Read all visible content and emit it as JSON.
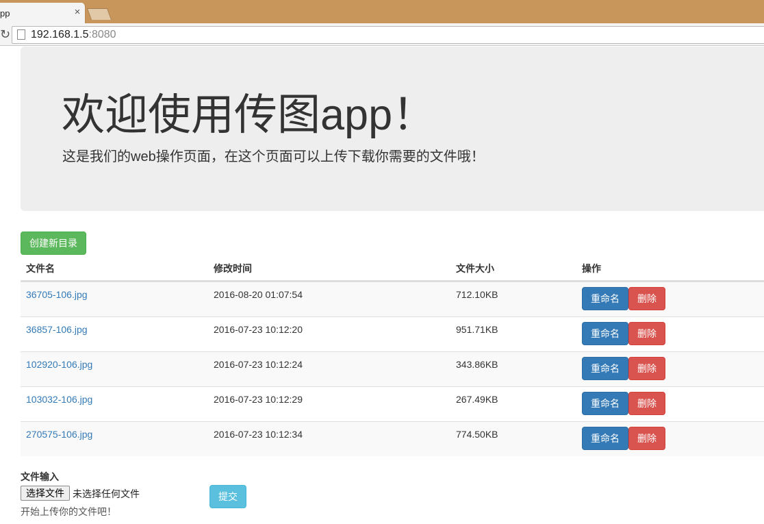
{
  "browser": {
    "tab_title": "pp",
    "close_glyph": "×",
    "url_host": "192.168.1.5",
    "url_port": ":8080"
  },
  "jumbotron": {
    "title": "欢迎使用传图app！",
    "subtitle": "这是我们的web操作页面，在这个页面可以上传下载你需要的文件哦！"
  },
  "actions": {
    "create_dir_label": "创建新目录"
  },
  "table": {
    "headers": [
      "文件名",
      "修改时间",
      "文件大小",
      "操作"
    ],
    "rename_label": "重命名",
    "delete_label": "删除",
    "rows": [
      {
        "name": "36705-106.jpg",
        "modified": "2016-08-20 01:07:54",
        "size": "712.10KB"
      },
      {
        "name": "36857-106.jpg",
        "modified": "2016-07-23 10:12:20",
        "size": "951.71KB"
      },
      {
        "name": "102920-106.jpg",
        "modified": "2016-07-23 10:12:24",
        "size": "343.86KB"
      },
      {
        "name": "103032-106.jpg",
        "modified": "2016-07-23 10:12:29",
        "size": "267.49KB"
      },
      {
        "name": "270575-106.jpg",
        "modified": "2016-07-23 10:12:34",
        "size": "774.50KB"
      }
    ]
  },
  "upload": {
    "label": "文件输入",
    "choose_label": "选择文件",
    "no_file_text": "未选择任何文件",
    "help_text": "开始上传你的文件吧！",
    "submit_label": "提交"
  },
  "colors": {
    "tabstrip": "#c8955b",
    "success": "#5cb85c",
    "primary": "#337ab7",
    "danger": "#d9534f",
    "info": "#5bc0de"
  }
}
